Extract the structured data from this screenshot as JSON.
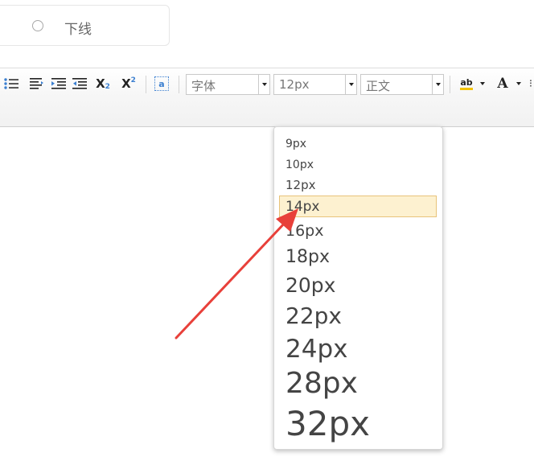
{
  "radio": {
    "label": "下线"
  },
  "toolbar": {
    "font_family": "字体",
    "font_size": "12px",
    "paragraph": "正文",
    "subscript_glyph": "X",
    "superscript_glyph": "X",
    "font_color_glyph": "A",
    "highlight_glyph": "ab",
    "cleartext_glyph": "a"
  },
  "font_size_menu": {
    "options": [
      "9px",
      "10px",
      "12px",
      "14px",
      "16px",
      "18px",
      "20px",
      "22px",
      "24px",
      "28px",
      "32px"
    ],
    "highlighted": "14px",
    "highlight_color": "#fdf1d0",
    "highlight_border": "#e8c37a"
  },
  "annotation": {
    "arrow_color": "#e8403a"
  }
}
